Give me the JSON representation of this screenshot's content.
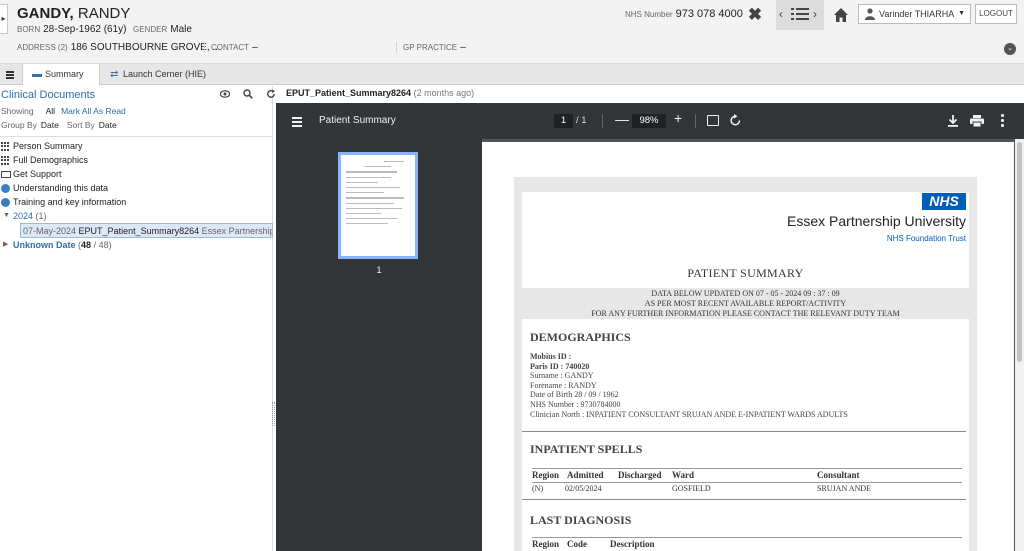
{
  "patient": {
    "surname": "GANDY,",
    "forename": "RANDY",
    "born_label": "BORN",
    "born_value": "28-Sep-1962 (61y)",
    "gender_label": "GENDER",
    "gender_value": "Male",
    "address_label": "ADDRESS (2)",
    "address_value": "186 SOUTHBOURNE GROVE, ...",
    "contact_label": "CONTACT",
    "contact_value": "–",
    "gp_label": "GP PRACTICE",
    "gp_value": "–",
    "nhs_label": "NHS Number",
    "nhs_value": "973 078 4000"
  },
  "header": {
    "collapse_glyph": "▸",
    "close_glyph": "✖",
    "prev_glyph": "‹",
    "next_glyph": "›",
    "user_name": "Varinder THIARHA",
    "user_caret": "▼",
    "logout_label": "LOGOUT",
    "expand_glyph": "⌄"
  },
  "tabs": [
    {
      "label": "Summary",
      "icon": "▬"
    },
    {
      "label": "Launch Cerner (HIE)",
      "icon": "⇄"
    }
  ],
  "left": {
    "title": "Clinical Documents",
    "icons": "◉🔍↻",
    "showing_label": "Showing",
    "showing_value": "All",
    "mark_all": "Mark All As Read",
    "group_label": "Group By",
    "group_value": "Date",
    "sort_label": "Sort By",
    "sort_value": "Date",
    "tree": {
      "person_summary": "Person Summary",
      "full_demographics": "Full Demographics",
      "get_support": "Get Support",
      "understanding": "Understanding this data",
      "training": "Training and key information",
      "year": "2024",
      "year_count": "(1)",
      "year_tri": "▼",
      "doc_date": "07-May-2024",
      "doc_name": "EPUT_Patient_Summary8264",
      "doc_org": "Essex Partnership",
      "unknown_tri": "▶",
      "unknown_label": "Unknown Date",
      "unknown_bold": "48",
      "unknown_rest": "/ 48)",
      "unknown_open": "("
    }
  },
  "doc": {
    "filename": "EPUT_Patient_Summary8264",
    "ago": "(2 months ago)"
  },
  "viewer": {
    "title": "Patient Summary",
    "page_current": "1",
    "page_of": "/  1",
    "minus": "—",
    "zoom": "98%",
    "plus": "+",
    "thumb_num": "1"
  },
  "pdf": {
    "nhs_logo": "NHS",
    "org_name": "Essex Partnership University",
    "org_sub": "NHS Foundation Trust",
    "title": "PATIENT SUMMARY",
    "updated_1": "DATA BELOW UPDATED ON 07 - 05 - 2024   09 : 37 : 09",
    "updated_2": "AS PER MOST RECENT AVAILABLE REPORT/ACTIVITY",
    "updated_3": "FOR ANY FURTHER INFORMATION PLEASE CONTACT THE RELEVANT DUTY TEAM",
    "demographics_title": "DEMOGRAPHICS",
    "mobius": "Mobius ID :",
    "paris": "Paris ID : 740020",
    "surname": "Surname : GANDY",
    "forename": "Forename : RANDY",
    "dob": "Date of Birth 28 / 09 / 1962",
    "nhs": "NHS Number : 9730784000",
    "clinician": "Clinician  North : INPATIENT CONSULTANT SRUJAN ANDE E-INPATIENT WARDS ADULTS",
    "inpatient_title": "INPATIENT SPELLS",
    "spells_headers": [
      "Region",
      "Admitted",
      "Discharged",
      "Ward",
      "Consultant"
    ],
    "spells_row": [
      "(N)",
      "02/05/2024",
      "GOSFIELD",
      "SRUJAN ANDE"
    ],
    "diagnosis_title": "LAST DIAGNOSIS",
    "diag_headers": [
      "Region",
      "Code",
      "Description"
    ]
  }
}
